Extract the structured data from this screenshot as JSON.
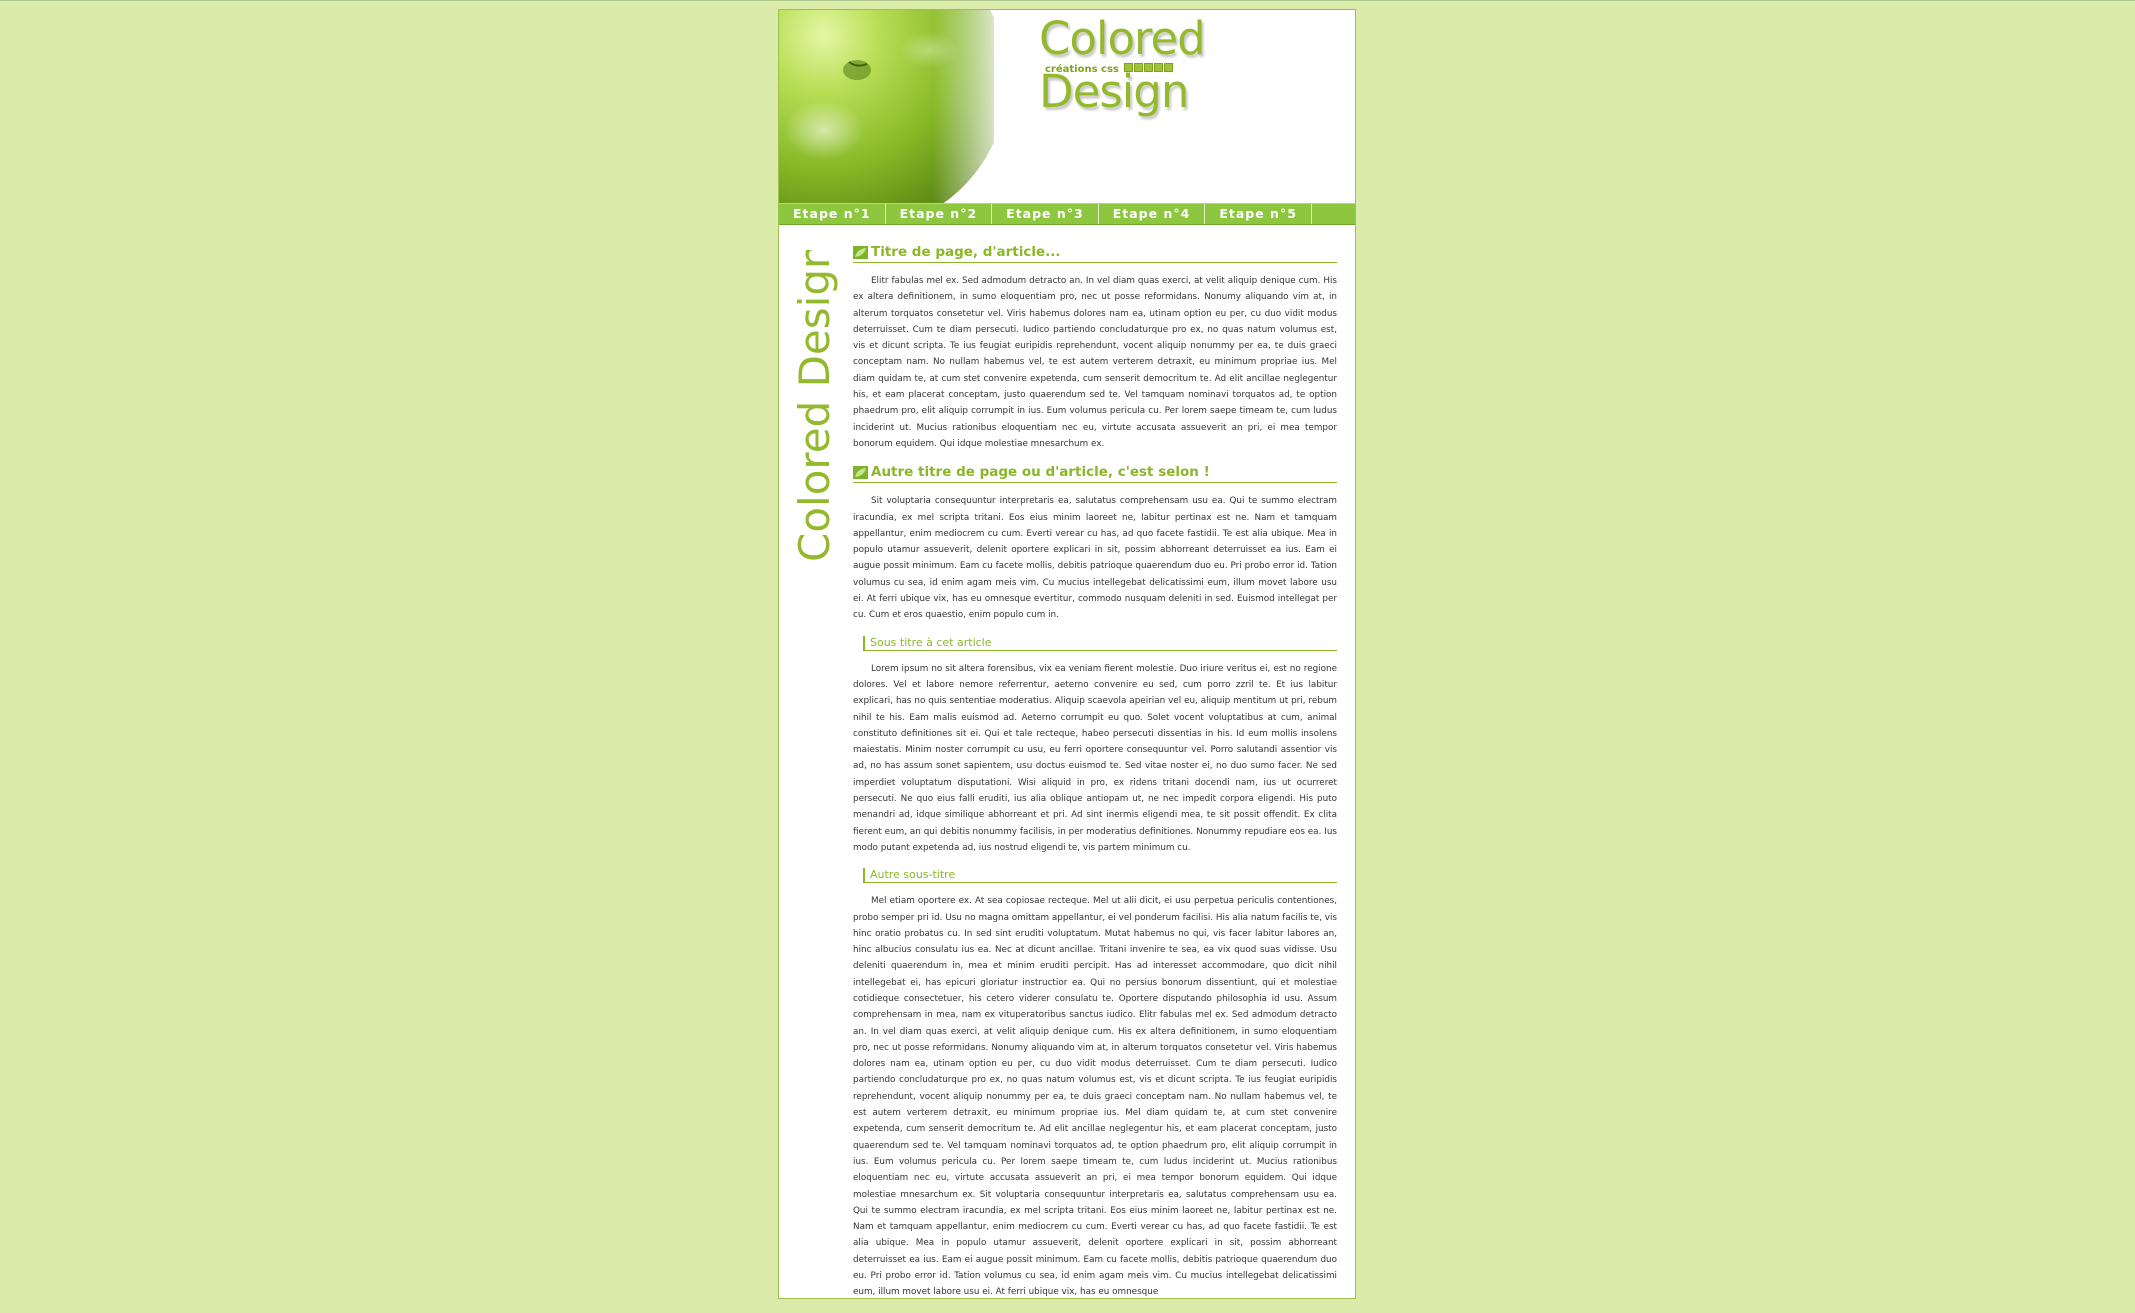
{
  "colors": {
    "page_background": "#dbebaa",
    "accent_green": "#8dc63f",
    "title_green": "#94b92d"
  },
  "header": {
    "site_title": "Colored Design",
    "tagline": "créations css",
    "image_icon": "green-apple"
  },
  "nav": {
    "items": [
      {
        "label": "Etape n°1"
      },
      {
        "label": "Etape n°2"
      },
      {
        "label": "Etape n°3"
      },
      {
        "label": "Etape n°4"
      },
      {
        "label": "Etape n°5"
      }
    ]
  },
  "sidebar": {
    "vertical_logo_text": "Colored Design"
  },
  "content": {
    "article1": {
      "title": "Titre de page, d'article...",
      "paragraph": "Elitr fabulas mel ex. Sed admodum detracto an. In vel diam quas exerci, at velit aliquip denique cum. His ex altera definitionem, in sumo eloquentiam pro, nec ut posse reformidans. Nonumy aliquando vim at, in alterum torquatos consetetur vel. Viris habemus dolores nam ea, utinam option eu per, cu duo vidit modus deterruisset. Cum te diam persecuti. Iudico partiendo concludaturque pro ex, no quas natum volumus est, vis et dicunt scripta. Te ius feugiat euripidis reprehendunt, vocent aliquip nonummy per ea, te duis graeci conceptam nam. No nullam habemus vel, te est autem verterem detraxit, eu minimum propriae ius. Mel diam quidam te, at cum stet convenire expetenda, cum senserit democritum te. Ad elit ancillae neglegentur his, et eam placerat conceptam, justo quaerendum sed te. Vel tamquam nominavi torquatos ad, te option phaedrum pro, elit aliquip corrumpit in ius. Eum volumus pericula cu. Per lorem saepe timeam te, cum ludus inciderint ut. Mucius rationibus eloquentiam nec eu, virtute accusata assueverit an pri, ei mea tempor bonorum equidem. Qui idque molestiae mnesarchum ex."
    },
    "article2": {
      "title": "Autre titre de page ou d'article, c'est selon !",
      "paragraph": "Sit voluptaria consequuntur interpretaris ea, salutatus comprehensam usu ea. Qui te summo electram iracundia, ex mel scripta tritani. Eos eius minim laoreet ne, labitur pertinax est ne. Nam et tamquam appellantur, enim mediocrem cu cum. Everti verear cu has, ad quo facete fastidii. Te est alia ubique. Mea in populo utamur assueverit, delenit oportere explicari in sit, possim abhorreant deterruisset ea ius. Eam ei augue possit minimum. Eam cu facete mollis, debitis patrioque quaerendum duo eu. Pri probo error id. Tation volumus cu sea, id enim agam meis vim. Cu mucius intellegebat delicatissimi eum, illum movet labore usu ei. At ferri ubique vix, has eu omnesque evertitur, commodo nusquam deleniti in sed. Euismod intellegat per cu. Cum et eros quaestio, enim populo cum in.",
      "subsection1": {
        "title": "Sous titre à cet article",
        "paragraph": "Lorem ipsum no sit altera forensibus, vix ea veniam fierent molestie. Duo iriure veritus ei, est no regione dolores. Vel et labore nemore referrentur, aeterno convenire eu sed, cum porro zzril te. Et ius labitur explicari, has no quis sententiae moderatius. Aliquip scaevola apeirian vel eu, aliquip mentitum ut pri, rebum nihil te his. Eam malis euismod ad. Aeterno corrumpit eu quo. Solet vocent voluptatibus at cum, animal constituto definitiones sit ei. Qui et tale recteque, habeo persecuti dissentias in his. Id eum mollis insolens maiestatis. Minim noster corrumpit cu usu, eu ferri oportere consequuntur vel. Porro salutandi assentior vis ad, no has assum sonet sapientem, usu doctus euismod te. Sed vitae noster ei, no duo sumo facer. Ne sed imperdiet voluptatum disputationi. Wisi aliquid in pro, ex ridens tritani docendi nam, ius ut ocurreret persecuti. Ne quo eius falli eruditi, ius alia oblique antiopam ut, ne nec impedit corpora eligendi. His puto menandri ad, idque similique abhorreant et pri. Ad sint inermis eligendi mea, te sit possit offendit. Ex clita fierent eum, an qui debitis nonummy facilisis, in per moderatius definitiones. Nonummy repudiare eos ea. Ius modo putant expetenda ad, ius nostrud eligendi te, vis partem minimum cu."
      },
      "subsection2": {
        "title": "Autre sous-titre",
        "paragraph": "Mel etiam oportere ex. At sea copiosae recteque. Mel ut alii dicit, ei usu perpetua periculis contentiones, probo semper pri id. Usu no magna omittam appellantur, ei vel ponderum facilisi. His alia natum facilis te, vis hinc oratio probatus cu. In sed sint eruditi voluptatum. Mutat habemus no qui, vis facer labitur labores an, hinc albucius consulatu ius ea. Nec at dicunt ancillae. Tritani invenire te sea, ea vix quod suas vidisse. Usu deleniti quaerendum in, mea et minim eruditi percipit. Has ad interesset accommodare, quo dicit nihil intellegebat ei, has epicuri gloriatur instructior ea. Qui no persius bonorum dissentiunt, qui et molestiae cotidieque consectetuer, his cetero viderer consulatu te. Oportere disputando philosophia id usu. Assum comprehensam in mea, nam ex vituperatoribus sanctus iudico. Elitr fabulas mel ex. Sed admodum detracto an. In vel diam quas exerci, at velit aliquip denique cum. His ex altera definitionem, in sumo eloquentiam pro, nec ut posse reformidans. Nonumy aliquando vim at, in alterum torquatos consetetur vel. Viris habemus dolores nam ea, utinam option eu per, cu duo vidit modus deterruisset. Cum te diam persecuti. Iudico partiendo concludaturque pro ex, no quas natum volumus est, vis et dicunt scripta. Te ius feugiat euripidis reprehendunt, vocent aliquip nonummy per ea, te duis graeci conceptam nam. No nullam habemus vel, te est autem verterem detraxit, eu minimum propriae ius. Mel diam quidam te, at cum stet convenire expetenda, cum senserit democritum te. Ad elit ancillae neglegentur his, et eam placerat conceptam, justo quaerendum sed te. Vel tamquam nominavi torquatos ad, te option phaedrum pro, elit aliquip corrumpit in ius. Eum volumus pericula cu. Per lorem saepe timeam te, cum ludus inciderint ut. Mucius rationibus eloquentiam nec eu, virtute accusata assueverit an pri, ei mea tempor bonorum equidem. Qui idque molestiae mnesarchum ex. Sit voluptaria consequuntur interpretaris ea, salutatus comprehensam usu ea. Qui te summo electram iracundia, ex mel scripta tritani. Eos eius minim laoreet ne, labitur pertinax est ne. Nam et tamquam appellantur, enim mediocrem cu cum. Everti verear cu has, ad quo facete fastidii. Te est alia ubique. Mea in populo utamur assueverit, delenit oportere explicari in sit, possim abhorreant deterruisset ea ius. Eam ei augue possit minimum. Eam cu facete mollis, debitis patrioque quaerendum duo eu. Pri probo error id. Tation volumus cu sea, id enim agam meis vim. Cu mucius intellegebat delicatissimi eum, illum movet labore usu ei. At ferri ubique vix, has eu omnesque"
      }
    }
  }
}
